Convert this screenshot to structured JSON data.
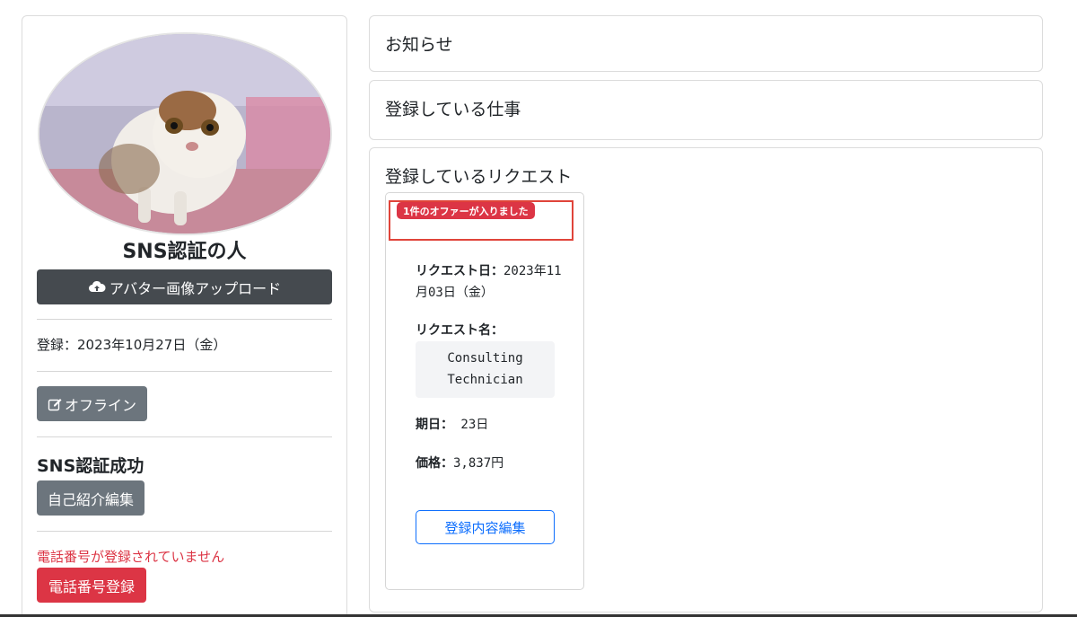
{
  "profile": {
    "name": "SNS認証の人",
    "upload_avatar_label": "アバター画像アップロード",
    "registered": "登録：2023年10月27日（金）",
    "offline_label": "オフライン",
    "sns_status": "SNS認証成功",
    "edit_intro_label": "自己紹介編集",
    "phone_warning": "電話番号が登録されていません",
    "register_phone_label": "電話番号登録"
  },
  "news": {
    "title": "お知らせ"
  },
  "jobs": {
    "title": "登録している仕事"
  },
  "requests": {
    "title": "登録しているリクエスト",
    "items": [
      {
        "offer_badge": "1件のオファーが入りました",
        "date_label": "リクエスト日：",
        "date_value": "2023年11月03日（金）",
        "name_label": "リクエスト名：",
        "name_value": "Consulting Technician",
        "period_label": "期日：",
        "period_value": " 23日",
        "price_label": "価格：",
        "price_value": "3,837円",
        "edit_label": "登録内容編集"
      }
    ]
  },
  "colors": {
    "danger": "#dc3545",
    "dark_button": "#454a4f",
    "secondary_button": "#6c757d",
    "primary": "#0d6efd",
    "highlight_border": "#e0443a"
  },
  "icons": {
    "upload": "cloud-upload-icon",
    "offline": "edit-square-icon"
  }
}
